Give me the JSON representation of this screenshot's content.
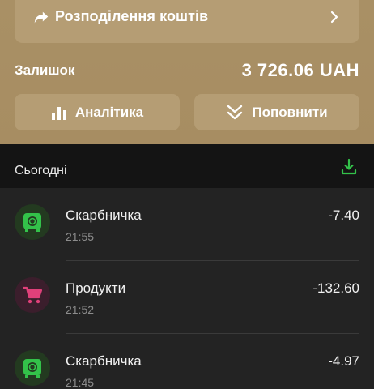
{
  "split": {
    "label": "Розподілення коштів"
  },
  "balance": {
    "label": "Залишок",
    "value": "3 726.06 UAH"
  },
  "actions": {
    "analytics_label": "Аналітика",
    "topup_label": "Поповнити"
  },
  "section": {
    "title": "Сьогодні"
  },
  "transactions": [
    {
      "name": "Скарбничка",
      "time": "21:55",
      "amount": "-7.40",
      "icon": "piggy-bank-icon"
    },
    {
      "name": "Продукти",
      "time": "21:52",
      "amount": "-132.60",
      "icon": "cart-icon"
    },
    {
      "name": "Скарбничка",
      "time": "21:45",
      "amount": "-4.97",
      "icon": "piggy-bank-icon"
    }
  ],
  "colors": {
    "header_bg": "#a99065",
    "card_bg": "#b59d74",
    "accent_green": "#33c24a",
    "accent_pink": "#e0407a"
  }
}
